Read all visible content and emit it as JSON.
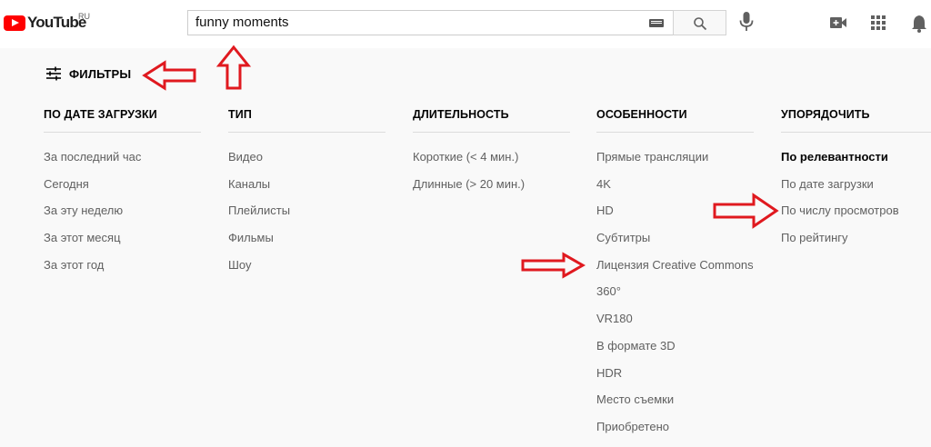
{
  "header": {
    "logo_text": "YouTube",
    "logo_region": "RU",
    "search_value": "funny moments"
  },
  "filters": {
    "label": "ФИЛЬТРЫ",
    "columns": [
      {
        "title": "ПО ДАТЕ ЗАГРУЗКИ",
        "items": [
          "За последний час",
          "Сегодня",
          "За эту неделю",
          "За этот месяц",
          "За этот год"
        ]
      },
      {
        "title": "ТИП",
        "items": [
          "Видео",
          "Каналы",
          "Плейлисты",
          "Фильмы",
          "Шоу"
        ]
      },
      {
        "title": "ДЛИТЕЛЬНОСТЬ",
        "items": [
          "Короткие (< 4 мин.)",
          "Длинные (> 20 мин.)"
        ]
      },
      {
        "title": "ОСОБЕННОСТИ",
        "items": [
          "Прямые трансляции",
          "4K",
          "HD",
          "Субтитры",
          "Лицензия Creative Commons",
          "360°",
          "VR180",
          "В формате 3D",
          "HDR",
          "Место съемки",
          "Приобретено"
        ]
      },
      {
        "title": "УПОРЯДОЧИТЬ",
        "items": [
          "По релевантности",
          "По дате загрузки",
          "По числу просмотров",
          "По рейтингу"
        ],
        "selected_index": 0
      }
    ]
  },
  "colors": {
    "brand_red": "#ff0000",
    "annotation_red": "#e0191f",
    "background": "#f9f9f9"
  },
  "icons": [
    "youtube-logo-icon",
    "keyboard-icon",
    "search-icon",
    "mic-icon",
    "video-camera-icon",
    "apps-grid-icon",
    "bell-icon",
    "filter-sliders-icon"
  ]
}
